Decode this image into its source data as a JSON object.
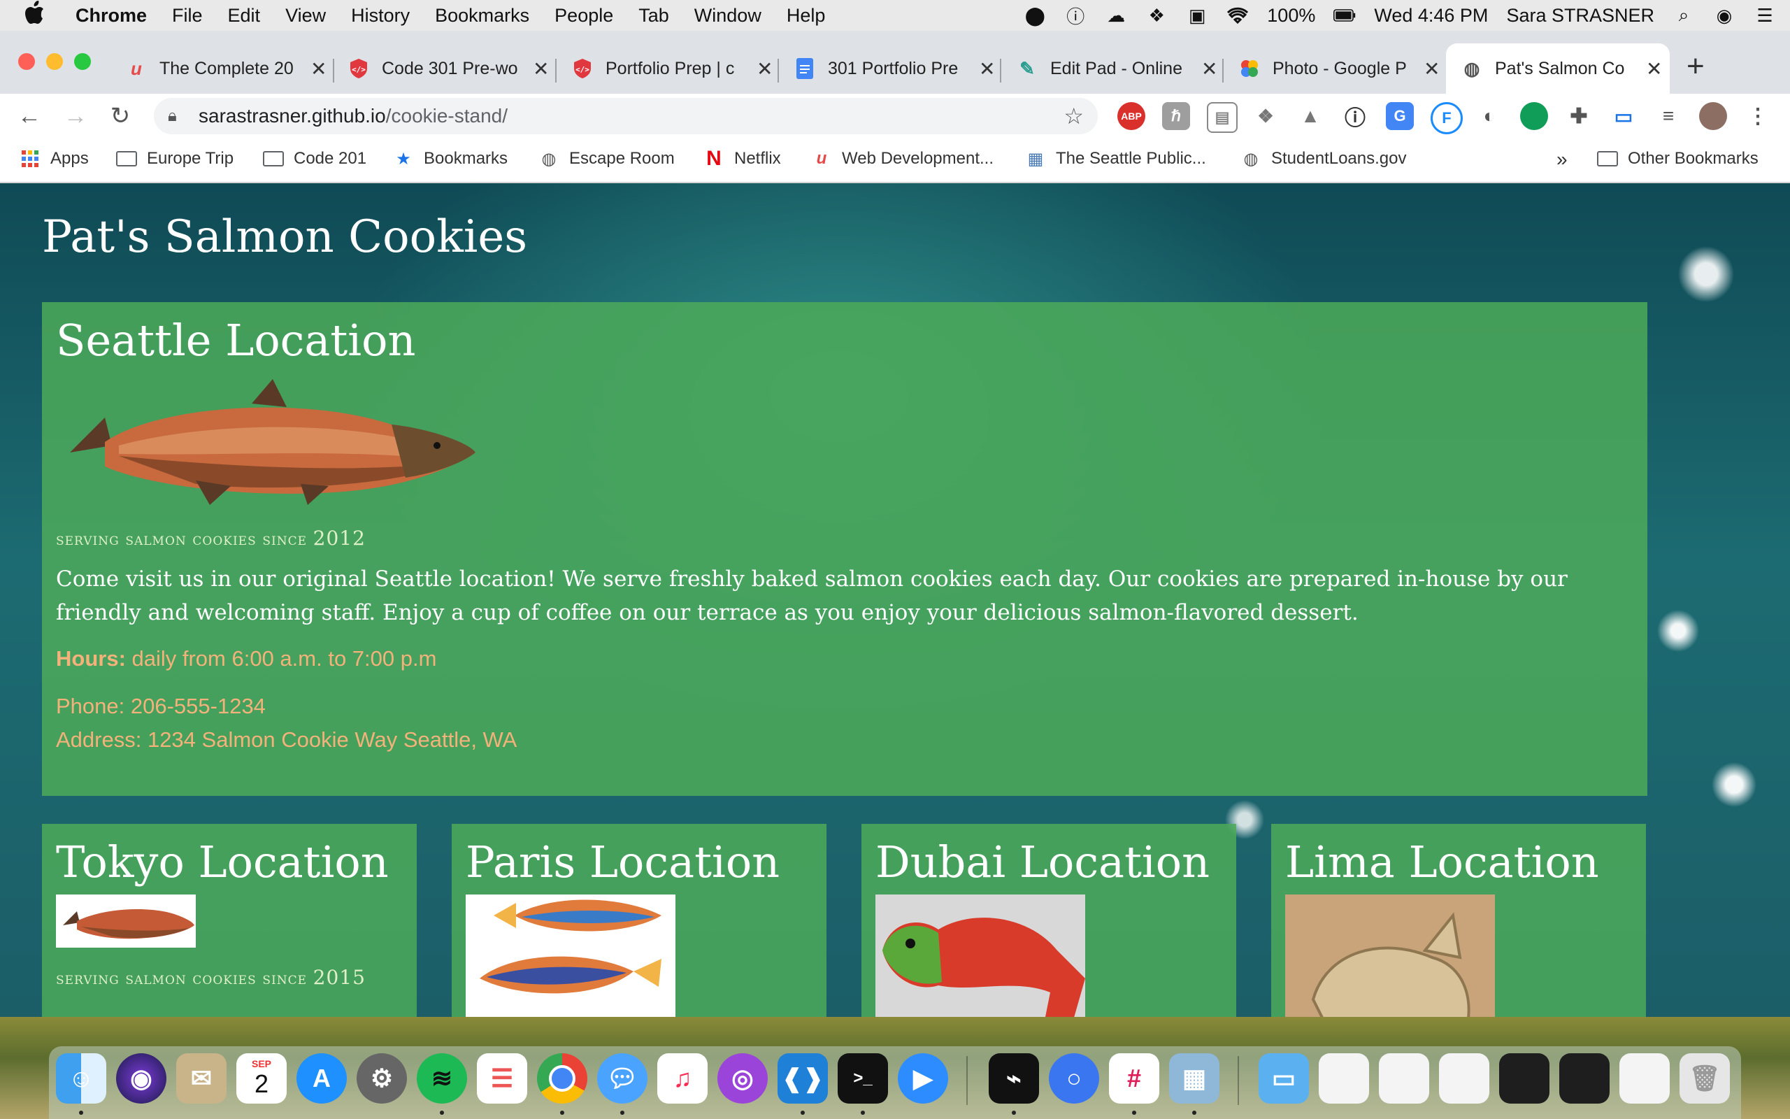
{
  "menubar": {
    "apple": "",
    "items": [
      "Chrome",
      "File",
      "Edit",
      "View",
      "History",
      "Bookmarks",
      "People",
      "Tab",
      "Window",
      "Help"
    ],
    "battery": "100%",
    "datetime": "Wed 4:46 PM",
    "user": "Sara STRASNER"
  },
  "tabs": [
    {
      "title": "The Complete 20",
      "favicon": "udemy-icon"
    },
    {
      "title": "Code 301 Pre-wo",
      "favicon": "codefellows-icon"
    },
    {
      "title": "Portfolio Prep | c",
      "favicon": "codefellows-icon"
    },
    {
      "title": "301 Portfolio Pre",
      "favicon": "google-docs-icon"
    },
    {
      "title": "Edit Pad - Online",
      "favicon": "editpad-icon"
    },
    {
      "title": "Photo - Google P",
      "favicon": "google-photos-icon"
    },
    {
      "title": "Pat's Salmon Co",
      "favicon": "globe-icon"
    }
  ],
  "omnibox": {
    "host": "sarastrasner.github.io",
    "path": "/cookie-stand/"
  },
  "bookmarks": {
    "items": [
      "Apps",
      "Europe Trip",
      "Code 201",
      "Bookmarks",
      "Escape Room",
      "Netflix",
      "Web Development...",
      "The Seattle Public...",
      "StudentLoans.gov"
    ],
    "overflow": "»",
    "other": "Other Bookmarks"
  },
  "page": {
    "title": "Pat's Salmon Cookies",
    "seattle": {
      "heading": "Seattle Location",
      "since_text": "serving salmon cookies since",
      "since_year": "2012",
      "description": "Come visit us in our original Seattle location! We serve freshly baked salmon cookies each day. Our cookies are prepared in-house by our friendly and welcoming staff. Enjoy a cup of coffee on our terrace as you enjoy your delicious salmon-flavored dessert.",
      "hours_label": "Hours:",
      "hours_value": " daily from 6:00 a.m. to 7:00 p.m",
      "phone": "Phone: 206-555-1234",
      "address": "Address: 1234 Salmon Cookie Way Seattle, WA"
    },
    "tokyo": {
      "heading": "Tokyo Location",
      "since_text": "serving salmon cookies since",
      "since_year": "2015"
    },
    "paris": {
      "heading": "Paris Location"
    },
    "dubai": {
      "heading": "Dubai Location"
    },
    "lima": {
      "heading": "Lima Location"
    }
  },
  "dock": {
    "calendar_month": "SEP",
    "calendar_day": "2"
  }
}
